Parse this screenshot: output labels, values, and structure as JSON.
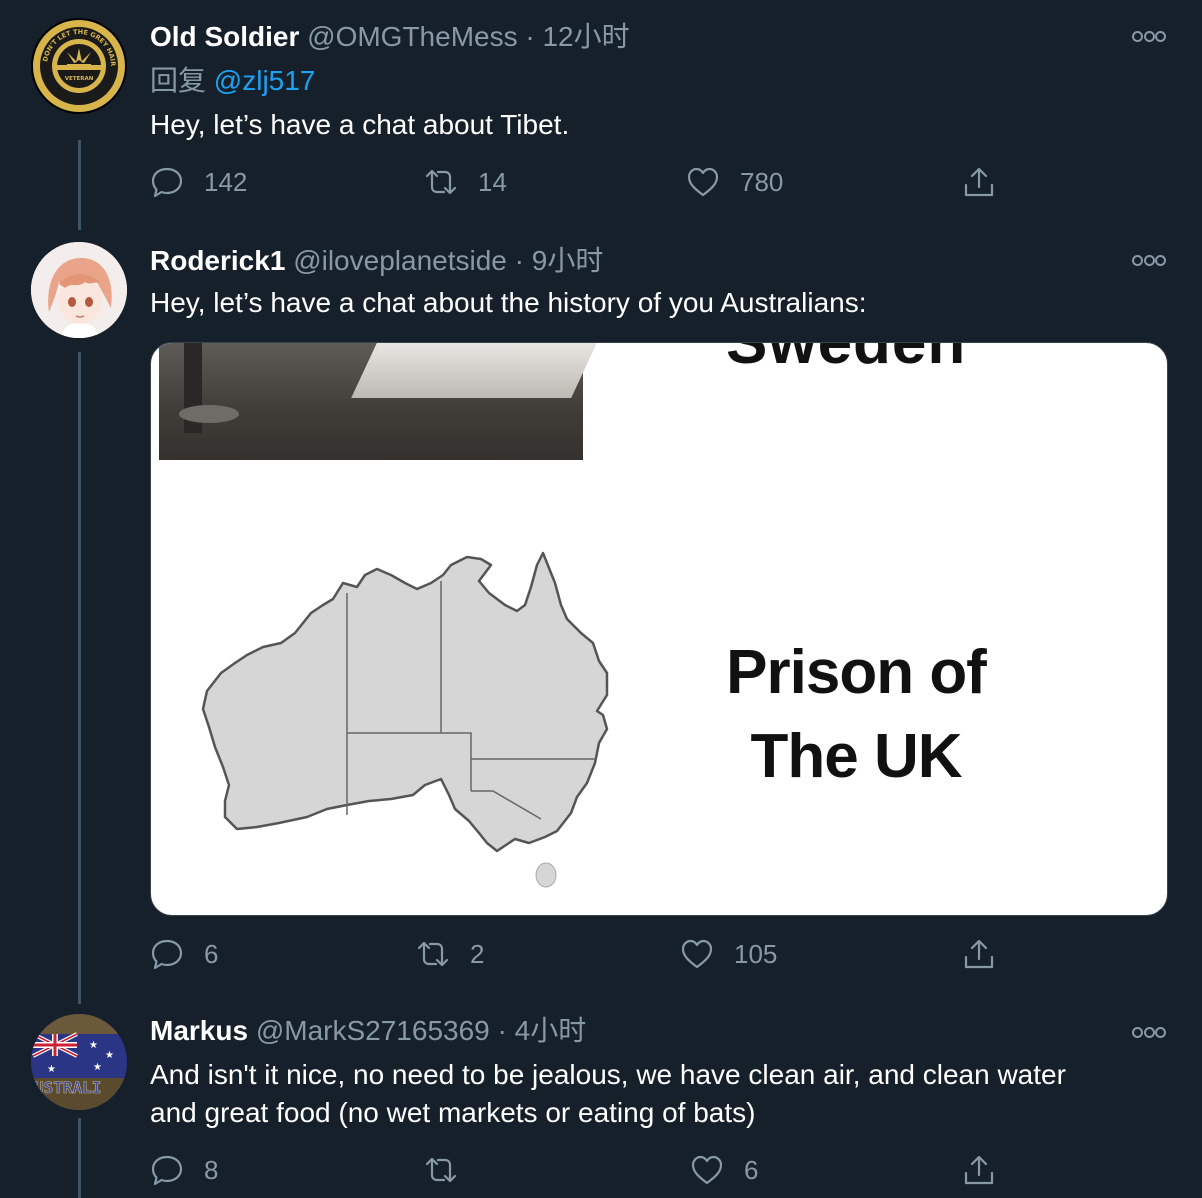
{
  "tweets": [
    {
      "name": "Old Soldier",
      "handle": "@OMGTheMess",
      "separator": "·",
      "time": "12小时",
      "reply_prefix": "回复",
      "reply_mention": "@zlj517",
      "text_lines": [
        "Hey, let’s have a chat about Tibet."
      ],
      "replies": "142",
      "retweets": "14",
      "likes": "780",
      "avatar_icon": "veteran-badge",
      "avatar_badge_text": "DON'T LET THE GREY HAIR FOOL YOU · VETERAN · WE CAN STILL KICK ARSE"
    },
    {
      "name": "Roderick1",
      "handle": "@iloveplanetside",
      "separator": "·",
      "time": "9小时",
      "text_lines": [
        "Hey, let’s have a chat about the history of you Australians:"
      ],
      "replies": "6",
      "retweets": "2",
      "likes": "105",
      "avatar_icon": "anime-character",
      "media": {
        "top_text": "Sweden",
        "caption_line1": "Prison of",
        "caption_line2": "The UK"
      }
    },
    {
      "name": "Markus",
      "handle": "@MarkS27165369",
      "separator": "·",
      "time": "4小时",
      "text_lines": [
        "And isn't it nice, no need to be jealous, we have clean air, and clean water",
        "and great food (no wet markets or eating of bats)"
      ],
      "replies": "8",
      "retweets": "",
      "likes": "6",
      "avatar_icon": "australia-flag",
      "avatar_text": "USTRALI"
    }
  ],
  "colors": {
    "background": "#15202b",
    "muted": "#8899a6",
    "link": "#1da1f2",
    "thread_line": "#3d5466"
  }
}
